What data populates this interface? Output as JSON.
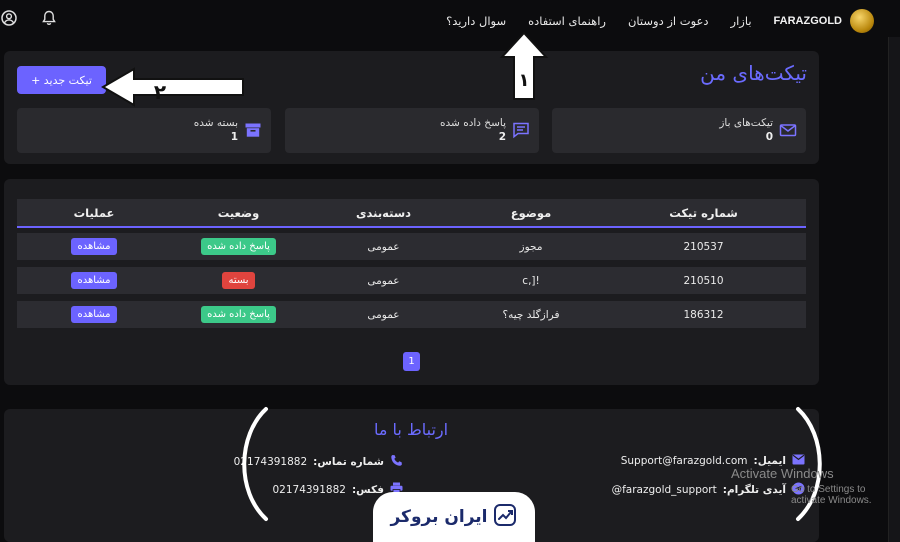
{
  "nav": {
    "brand": "FARAZGOLD",
    "links": [
      "بازار",
      "دعوت از دوستان",
      "راهنمای استفاده",
      "سوال دارید؟"
    ]
  },
  "header": {
    "title": "تیکت‌های من",
    "new_ticket_label": "تیکت جدید +"
  },
  "stats": {
    "open": {
      "label": "تیکت‌های باز",
      "count": "0"
    },
    "answered": {
      "label": "پاسخ داده شده",
      "count": "2"
    },
    "closed": {
      "label": "بسته شده",
      "count": "1"
    }
  },
  "annotations": {
    "arrow1": "۱",
    "arrow2": "۲"
  },
  "table": {
    "columns": [
      "شماره تیکت",
      "موضوع",
      "دسته‌بندی",
      "وضعیت",
      "عملیات"
    ],
    "rows": [
      {
        "id": "210537",
        "subject": "مجوز",
        "category": "عمومی",
        "status": "پاسخ داده شده",
        "status_color": "#3cc989",
        "action": "مشاهده"
      },
      {
        "id": "210510",
        "subject": "![,c",
        "category": "عمومی",
        "status": "بسته",
        "status_color": "#e0443e",
        "action": "مشاهده"
      },
      {
        "id": "186312",
        "subject": "فرازگلد چیه؟",
        "category": "عمومی",
        "status": "پاسخ داده شده",
        "status_color": "#3cc989",
        "action": "مشاهده"
      }
    ],
    "page": "1"
  },
  "footer": {
    "title": "ارتباط با ما",
    "email_key": "ایمیل:",
    "email_val": "Support@farazgold.com",
    "telegram_key": "آیدی تلگرام:",
    "telegram_val": "farazgold_support@",
    "phone_key": "شماره تماس:",
    "phone_val": "02174391882",
    "fax_key": "فکس:",
    "fax_val": "02174391882"
  },
  "watermark": {
    "line1": "Activate Windows",
    "line2": "Go to Settings to activate Windows."
  },
  "iranbroker": "ایران بروکر",
  "colors": {
    "accent": "#6c63ff",
    "success": "#3cc989",
    "danger": "#e0443e"
  }
}
